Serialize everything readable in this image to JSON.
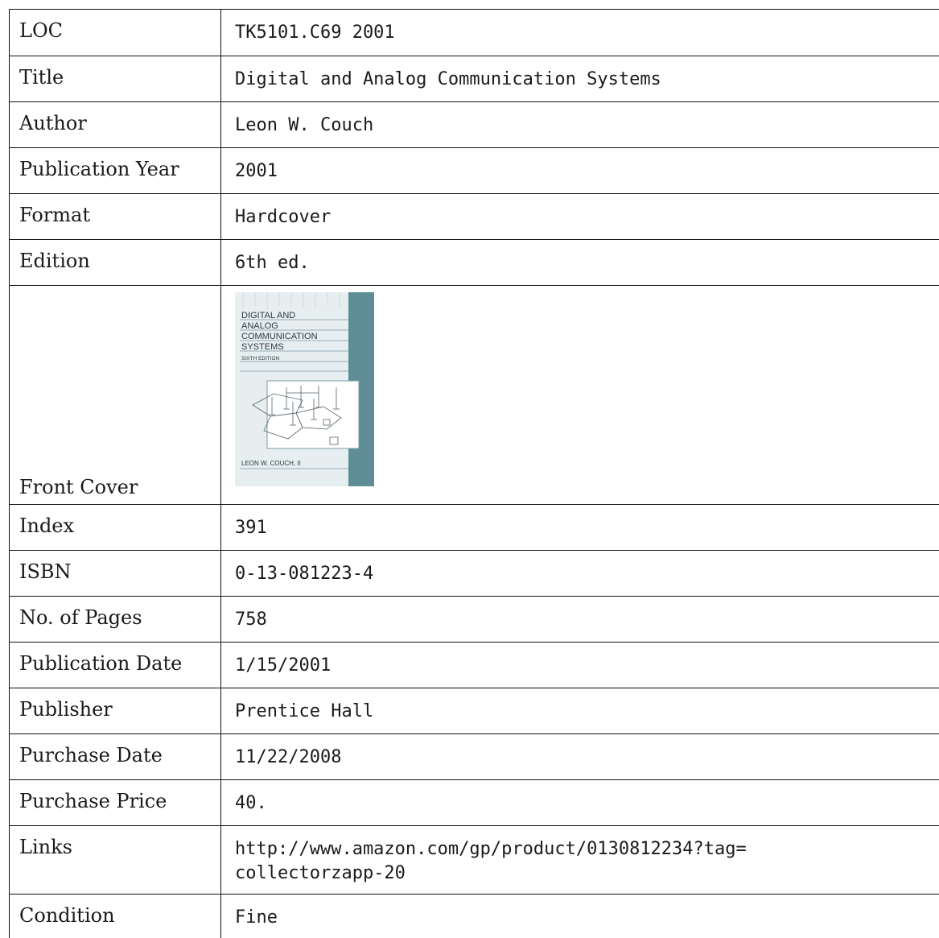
{
  "rows": [
    {
      "label": "LOC",
      "value": "TK5101.C69 2001"
    },
    {
      "label": "Title",
      "value": "Digital and Analog Communication Systems"
    },
    {
      "label": "Author",
      "value": "Leon W. Couch"
    },
    {
      "label": "Publication Year",
      "value": "2001"
    },
    {
      "label": "Format",
      "value": "Hardcover"
    },
    {
      "label": "Edition",
      "value": "6th ed."
    }
  ],
  "cover": {
    "label": "Front Cover",
    "title_lines": [
      "DIGITAL AND",
      "ANALOG",
      "COMMUNICATION",
      "SYSTEMS"
    ],
    "edition": "SIXTH EDITION",
    "author": "LEON W. COUCH, II",
    "colors": {
      "background": "#e6eef0",
      "spine": "#5e8d96",
      "line": "#7b9aa3"
    }
  },
  "rows2": [
    {
      "label": "Index",
      "value": "391"
    },
    {
      "label": "ISBN",
      "value": "0-13-081223-4"
    },
    {
      "label": "No. of Pages",
      "value": "758"
    },
    {
      "label": "Publication Date",
      "value": "1/15/2001"
    },
    {
      "label": "Publisher",
      "value": "Prentice Hall"
    },
    {
      "label": "Purchase Date",
      "value": "11/22/2008"
    },
    {
      "label": "Purchase Price",
      "value": "40."
    }
  ],
  "links": {
    "label": "Links",
    "line1": "http://www.amazon.com/gp/product/0130812234?tag=",
    "line2": "collectorzapp-20"
  },
  "condition": {
    "label": "Condition",
    "value": "Fine"
  }
}
